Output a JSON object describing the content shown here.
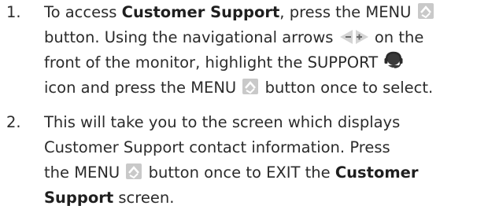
{
  "steps": [
    {
      "number": "1.",
      "segments": {
        "l1_a": "To access ",
        "l1_b": "Customer Support",
        "l1_c": ", press the MENU ",
        "l2_a": "button.  Using the navigational arrows ",
        "l2_b": " on the",
        "l3_a": "front of the monitor, highlight the SUPPORT ",
        "l4_a": "icon and press the MENU ",
        "l4_b": " button once to select."
      }
    },
    {
      "number": "2.",
      "segments": {
        "l1_a": "This will take you to the screen which displays",
        "l2_a": "Customer Support contact information. Press",
        "l3_a": "the MENU ",
        "l3_b": " button once to EXIT the ",
        "l3_c": "Customer",
        "l4_a": "Support",
        "l4_b": " screen."
      }
    }
  ],
  "icons": {
    "menu": "menu-button-icon",
    "nav_arrows": "navigation-arrows-icon",
    "support": "support-headset-icon"
  },
  "colors": {
    "text": "#2b2b2b",
    "menu_icon": "#b5b5b5",
    "arrow_icon": "#d4d4d4",
    "support_icon": "#3a3a3a"
  }
}
